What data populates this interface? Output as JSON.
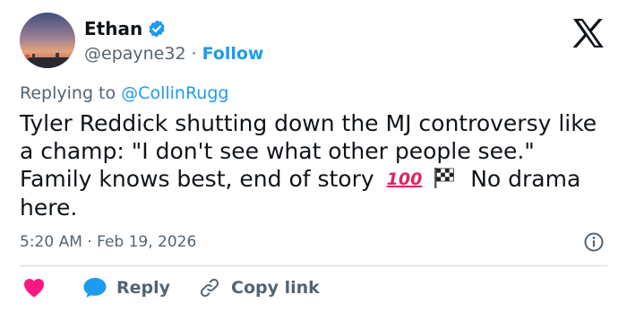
{
  "author": {
    "name": "Ethan",
    "handle": "@epayne32",
    "separator": "·",
    "follow_label": "Follow"
  },
  "reply_context": {
    "prefix": "Replying to",
    "mention": "@CollinRugg"
  },
  "tweet": {
    "text_before_emoji": "Tyler Reddick shutting down the MJ controversy like a champ: \"I don't see what other people see.\" Family knows best, end of story",
    "emoji_hundred": "100",
    "text_after_emoji": "No drama here."
  },
  "meta": {
    "time": "5:20 AM",
    "separator": "·",
    "date": "Feb 19, 2026"
  },
  "actions": {
    "reply_label": "Reply",
    "copy_link_label": "Copy link"
  },
  "colors": {
    "accent": "#1d9bf0",
    "heart": "#f91880",
    "text": "#0f1419",
    "secondary": "#536471",
    "divider": "#cfd9de"
  },
  "icons": [
    "avatar-sunset",
    "verified-badge-icon",
    "x-logo-icon",
    "hundred-points-emoji",
    "checkered-flag-emoji",
    "info-icon",
    "heart-icon",
    "reply-bubble-icon",
    "link-icon"
  ]
}
